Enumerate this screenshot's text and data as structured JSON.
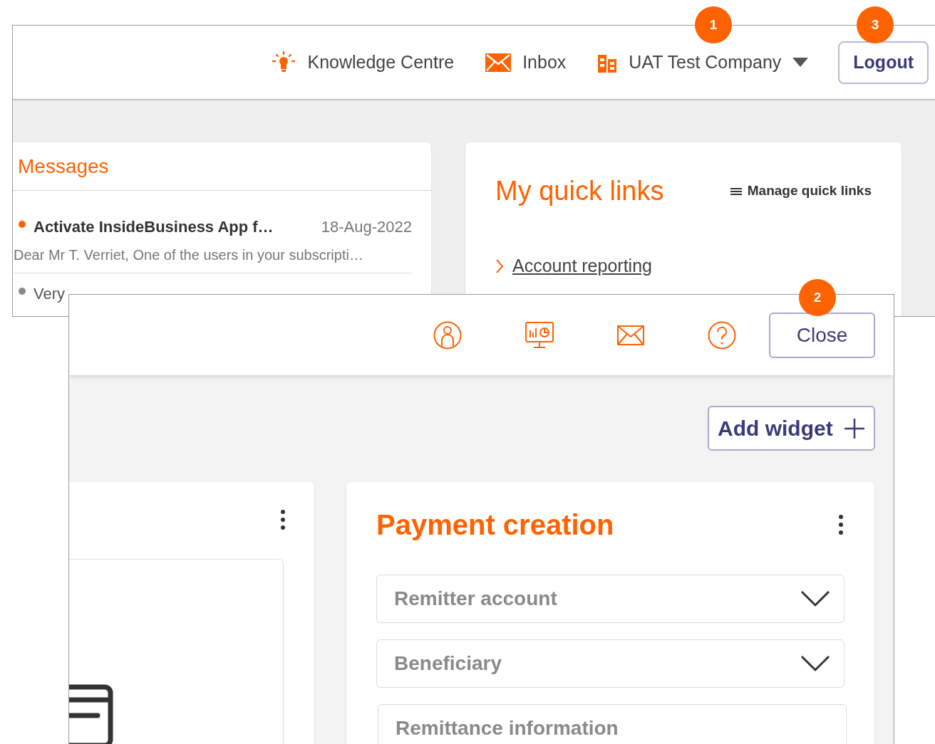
{
  "back_screen": {
    "header": {
      "links": [
        {
          "kind": "knowledge",
          "label": "Knowledge Centre"
        },
        {
          "kind": "inbox",
          "label": "Inbox"
        }
      ],
      "company": {
        "label": "UAT Test Company"
      },
      "logout_button": "Logout"
    },
    "messages": {
      "title": "Messages",
      "items": [
        {
          "subject": "Activate InsideBusiness App f…",
          "date": "18-Aug-2022",
          "preview": "Dear Mr T. Verriet, One of the users in your subscripti…",
          "unread": true
        },
        {
          "subject": "Very",
          "unread": false
        }
      ]
    },
    "quick_links": {
      "title": "My quick links",
      "manage": "Manage quick links",
      "links": [
        "Account reporting"
      ]
    }
  },
  "front_screen": {
    "close_button": "Close",
    "add_widget_button": "Add widget",
    "payment_creation": {
      "title": "Payment creation",
      "fields": [
        {
          "kind": "select",
          "placeholder": "Remitter account"
        },
        {
          "kind": "select",
          "placeholder": "Beneficiary"
        },
        {
          "kind": "text",
          "placeholder": "Remittance information"
        }
      ]
    }
  },
  "callouts": [
    {
      "number": "1"
    },
    {
      "number": "2"
    },
    {
      "number": "3"
    }
  ]
}
